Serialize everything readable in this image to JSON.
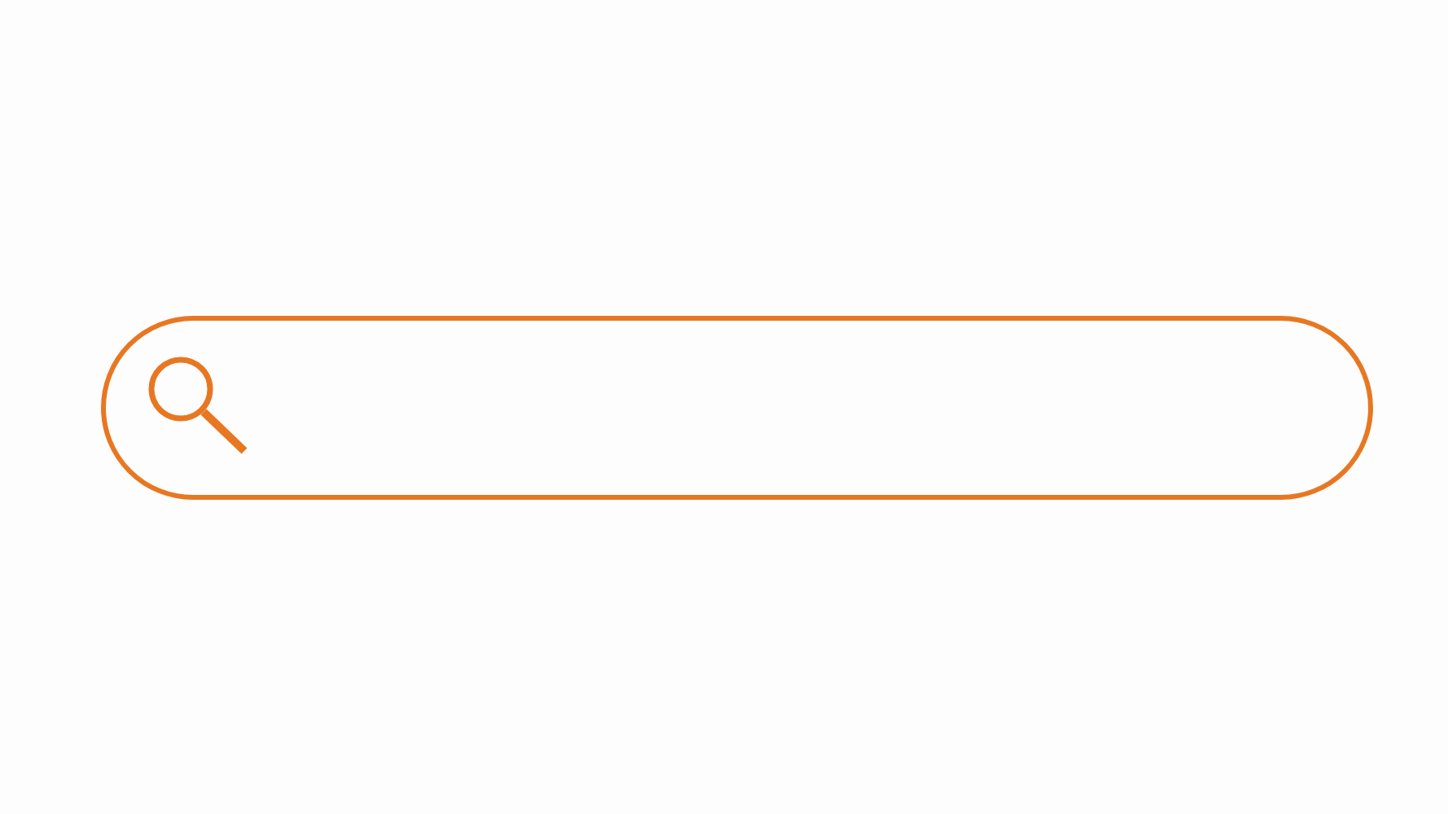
{
  "search_bar": {
    "kind": "search"
  }
}
